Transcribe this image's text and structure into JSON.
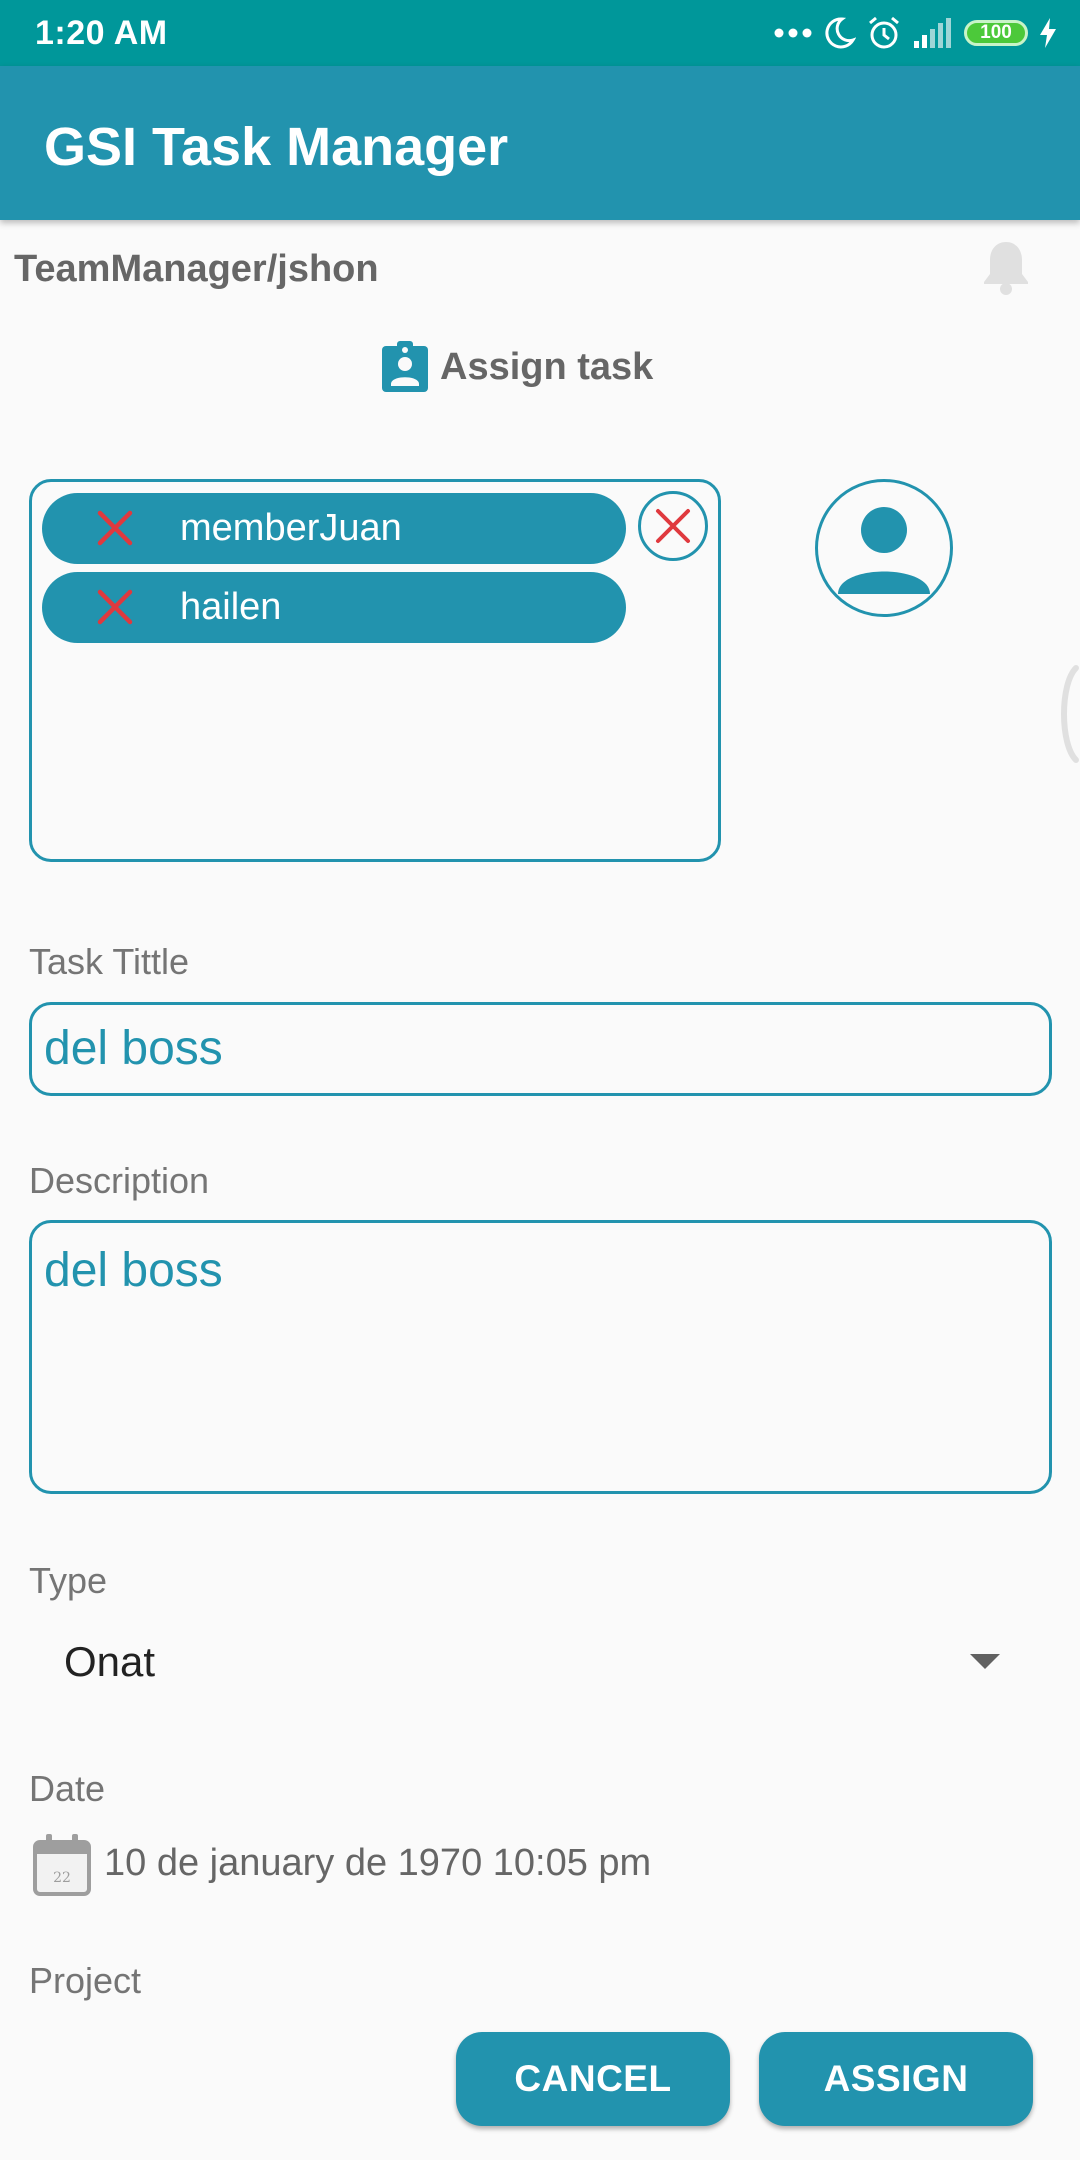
{
  "status_bar": {
    "time": "1:20 AM",
    "battery": "100",
    "icons": [
      "more-dots-icon",
      "moon-icon",
      "alarm-icon",
      "signal-icon",
      "battery-icon",
      "charging-icon"
    ]
  },
  "app_bar": {
    "title": "GSI Task Manager"
  },
  "header": {
    "user_path": "TeamManager/jshon",
    "notification_icon": "bell-icon"
  },
  "assign": {
    "heading": "Assign task",
    "icon": "assignment-ind-icon"
  },
  "members": {
    "chips": [
      {
        "label": "memberJuan"
      },
      {
        "label": "hailen"
      }
    ]
  },
  "form": {
    "title_label": "Task Tittle",
    "title_value": "del boss",
    "description_label": "Description",
    "description_value": "del boss",
    "type_label": "Type",
    "type_value": "Onat",
    "date_label": "Date",
    "date_value": "10 de january de 1970 10:05 pm",
    "calendar_day": "22",
    "project_label": "Project"
  },
  "actions": {
    "cancel": "CANCEL",
    "assign": "ASSIGN"
  },
  "colors": {
    "primary": "#2293ae",
    "status_bar": "#00979a",
    "remove_x": "#e0393e"
  }
}
